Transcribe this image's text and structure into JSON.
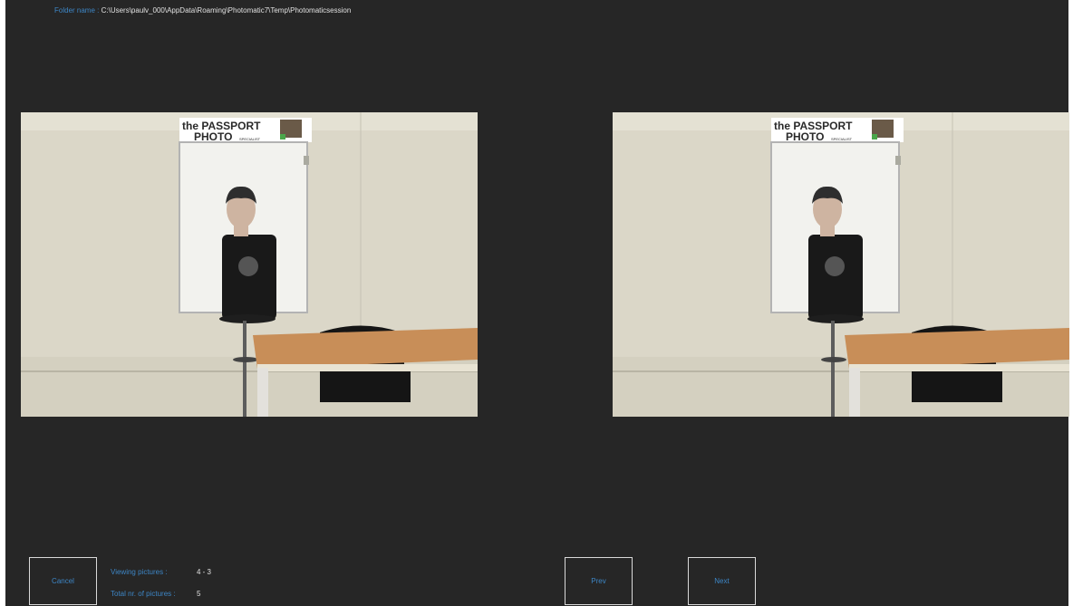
{
  "header": {
    "folder_label": "Folder name :",
    "folder_path": "C:\\Users\\paulv_000\\AppData\\Roaming\\Photomatic7\\Temp\\Photomaticsession"
  },
  "photos": [
    {
      "sign_line1": "the PASSPORT",
      "sign_line2": "PHOTO",
      "sign_small": "SPECIALIST"
    },
    {
      "sign_line1": "the PASSPORT",
      "sign_line2": "PHOTO",
      "sign_small": "SPECIALIST"
    }
  ],
  "footer": {
    "cancel_label": "Cancel",
    "viewing_label": "Viewing pictures :",
    "viewing_value": "4 - 3",
    "total_label": "Total nr. of pictures :",
    "total_value": "5",
    "prev_label": "Prev",
    "next_label": "Next"
  },
  "colors": {
    "background": "#262626",
    "label_blue": "#3d86c6",
    "text_light": "#e0e0e0",
    "button_border": "#d9d9d9"
  }
}
